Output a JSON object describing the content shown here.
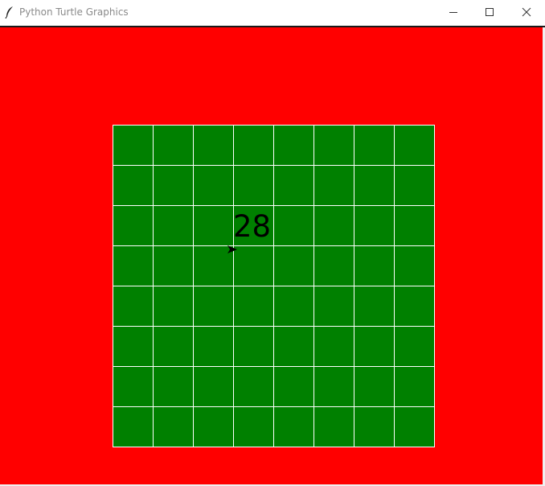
{
  "window": {
    "title": "Python Turtle Graphics",
    "icon": "feather-icon",
    "controls": [
      "minimize-icon",
      "maximize-icon",
      "close-icon"
    ]
  },
  "canvas": {
    "background_color": "#ff0000",
    "board": {
      "rows": 8,
      "cols": 8,
      "cell_color": "#008000",
      "grid_line_color": "#ffffff"
    },
    "turtle": {
      "icon": "arrow-turtle-icon",
      "heading": "east"
    },
    "score_text": "28"
  }
}
